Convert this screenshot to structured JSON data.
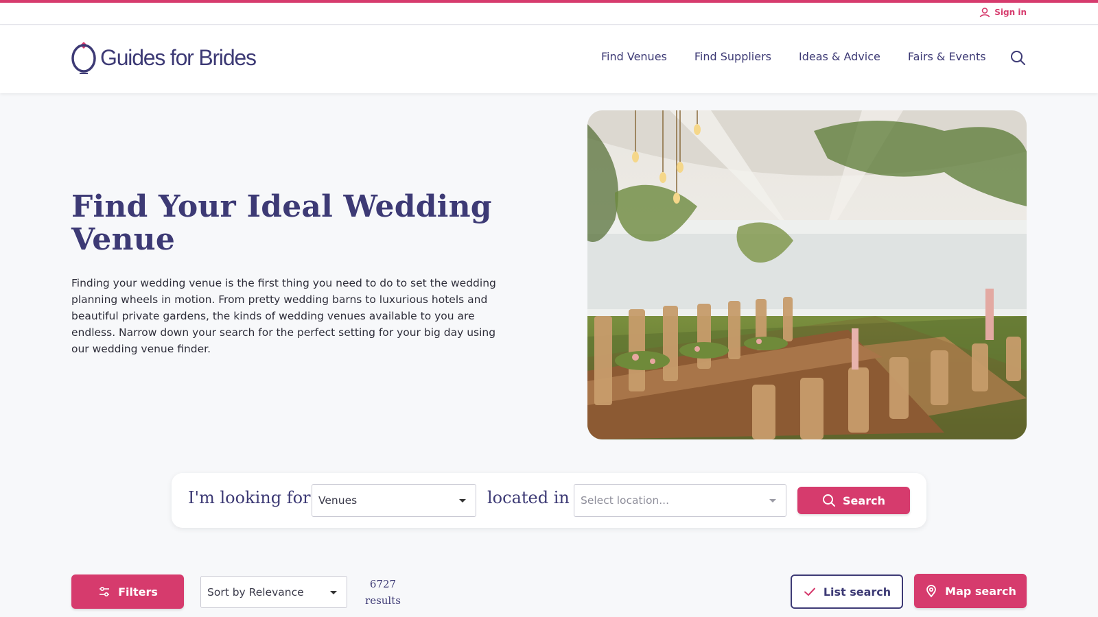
{
  "utility": {
    "signin_label": "Sign in"
  },
  "brand": {
    "name": "Guides for Brides"
  },
  "nav": {
    "items": [
      "Find Venues",
      "Find Suppliers",
      "Ideas & Advice",
      "Fairs & Events"
    ],
    "search_icon": "search-icon"
  },
  "hero": {
    "title": "Find Your Ideal Wedding Venue",
    "text": "Finding your wedding venue is the first thing you need to do to set the wedding planning wheels in motion. From pretty wedding barns to luxurious hotels and beautiful private gardens, the kinds of wedding venues available to you are endless. Narrow down your search for the perfect setting for your big day using our wedding venue finder."
  },
  "search": {
    "looking_label": "I'm looking for",
    "category_value": "Venues",
    "located_label": "located in",
    "location_placeholder": "Select location...",
    "button_label": "Search"
  },
  "toolbar": {
    "filters_label": "Filters",
    "sort_value": "Sort by Relevance",
    "results_count": "6727",
    "results_label": "results",
    "list_search_label": "List search",
    "map_search_label": "Map search"
  },
  "colors": {
    "accent": "#d63b6d",
    "brand_navy": "#3d3a75",
    "background": "#f7f8fa"
  }
}
